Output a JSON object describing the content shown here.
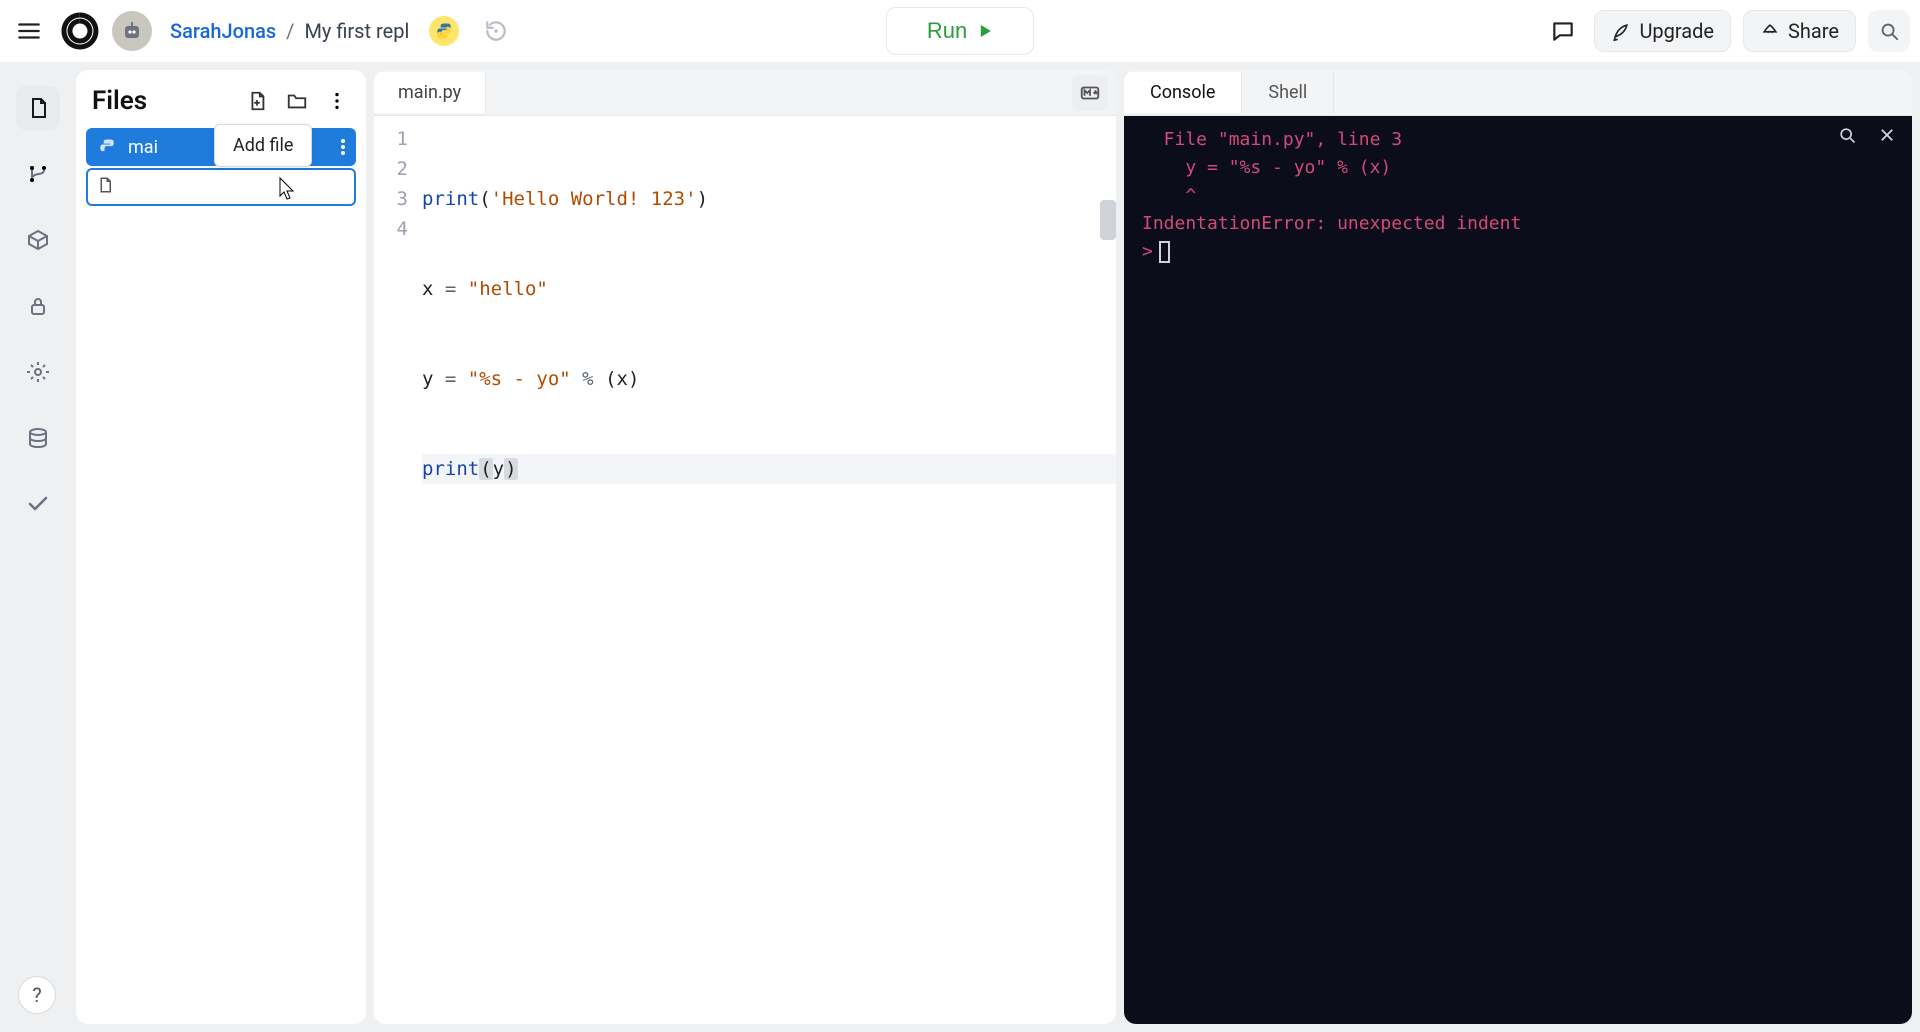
{
  "header": {
    "username": "SarahJonas",
    "separator": "/",
    "project": "My first repl",
    "run_label": "Run",
    "upgrade_label": "Upgrade",
    "share_label": "Share"
  },
  "files_panel": {
    "title": "Files",
    "tooltip_addfile": "Add file",
    "selected_file": "mai",
    "new_file_value": ""
  },
  "editor": {
    "tab": "main.py",
    "gutter": [
      "1",
      "2",
      "3",
      "4"
    ]
  },
  "code_lines": {
    "l1": {
      "pre": "print",
      "paren_open": "(",
      "str": "'Hello World! 123'",
      "paren_close": ")"
    },
    "l2": {
      "var": "x",
      "eq": " = ",
      "str": "\"hello\""
    },
    "l3": {
      "var": "y",
      "eq": " = ",
      "str": "\"%s - yo\"",
      "pct": " % ",
      "arg": "(x)"
    },
    "l4": {
      "pre": "print",
      "paren_open": "(",
      "hl1": "y",
      "paren_close": ")"
    }
  },
  "console": {
    "tab_console": "Console",
    "tab_shell": "Shell",
    "line1": "  File \"main.py\", line 3",
    "line2": "    y = \"%s - yo\" % (x)",
    "line3": "    ^",
    "line4": "IndentationError: unexpected indent",
    "prompt": ">"
  },
  "help": "?"
}
